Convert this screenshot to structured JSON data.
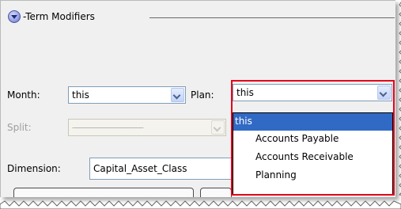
{
  "term_modifiers": {
    "title": "Term Modifiers"
  },
  "form": {
    "month_label": "Month:",
    "month_value": "this",
    "plan_label": "Plan:",
    "plan_value": "this",
    "split_label": "Split:",
    "split_value": "---------------------------",
    "dimension_label": "Dimension:",
    "dimension_value": "Capital_Asset_Class"
  },
  "plan_dropdown": {
    "options": [
      "this",
      "Accounts Payable",
      "Accounts Receivable",
      "Planning"
    ],
    "selected_index": 0
  },
  "colors": {
    "selection": "#316ac5",
    "callout_border": "#e3001b",
    "panel_background": "#f1f0f0"
  }
}
